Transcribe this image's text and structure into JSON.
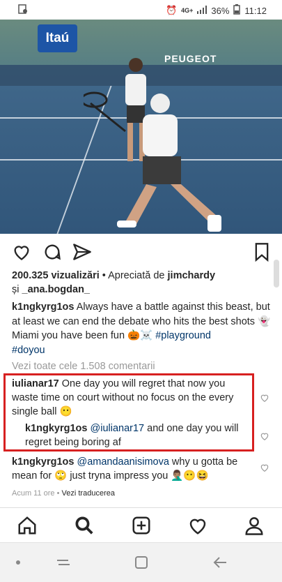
{
  "status_bar": {
    "left_icons": [
      "image-icon"
    ],
    "battery_percent": "36%",
    "time": "11:12",
    "network": "4G+"
  },
  "media": {
    "sponsor_left": "Itaú",
    "sponsor_right": "PEUGEOT"
  },
  "post": {
    "views": "200.325 vizualizări",
    "liked_prefix": " • Apreciată de ",
    "liked_user1": "jimchardy",
    "liked_and": "și ",
    "liked_user2": "_ana.bogdan_",
    "caption_user": "k1ngkyrg1os",
    "caption_text": " Always have a battle against this beast, but at least we can end the debate who hits the best shots 👻 Miami you have been fun 🎃☠️ ",
    "hashtag1": "#playground",
    "hashtag2": "#doyou",
    "view_all_comments": "Vezi toate cele 1.508 comentarii"
  },
  "comments": [
    {
      "user": "iulianar17",
      "text": " One day you will regret that now you waste time on court without no focus on the every single ball 😶"
    },
    {
      "user": "k1ngkyrg1os",
      "mention": "@iulianar17",
      "text": " and one day you will regret being boring af"
    },
    {
      "user": "k1ngkyrg1os",
      "mention": "@amandaanisimova",
      "text": " why u gotta be mean for 🙄 just tryna impress you 🤦🏽‍♂️😶😆"
    }
  ],
  "footer": {
    "time_ago": "Acum 11 ore",
    "separator": " • ",
    "translate": "Vezi traducerea"
  },
  "colors": {
    "highlight_border": "#d72020",
    "link": "#003569"
  }
}
